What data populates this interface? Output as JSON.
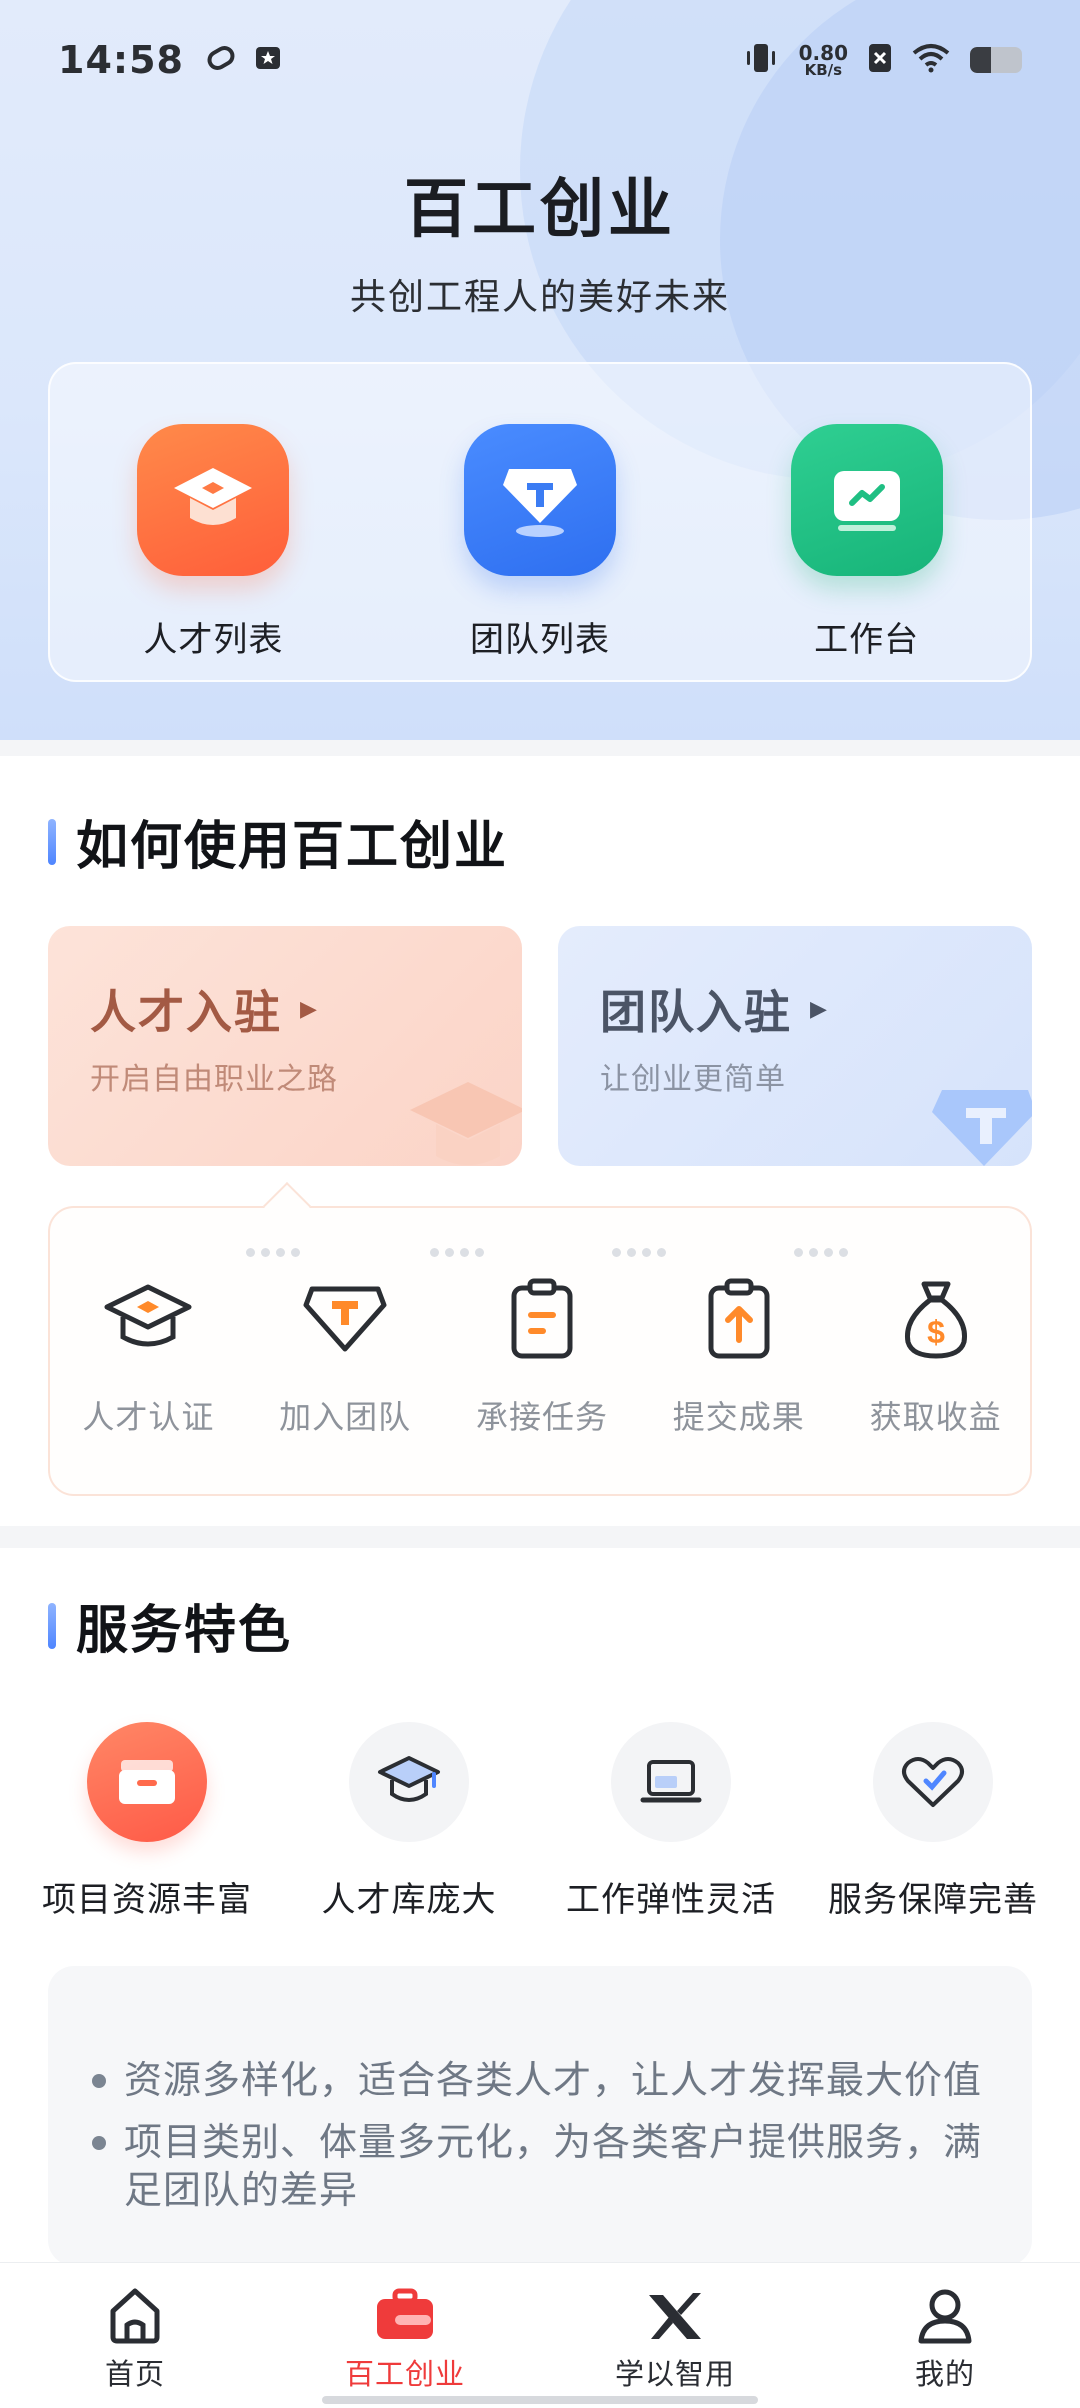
{
  "status": {
    "time": "14:58",
    "speed_value": "0.80",
    "speed_unit": "KB/s"
  },
  "header": {
    "title": "百工创业",
    "subtitle": "共创工程人的美好未来"
  },
  "quick_actions": [
    {
      "label": "人才列表",
      "icon": "graduation-cap-icon",
      "color": "#ff6b3d"
    },
    {
      "label": "团队列表",
      "icon": "team-gem-icon",
      "color": "#3a7cf5"
    },
    {
      "label": "工作台",
      "icon": "dashboard-monitor-icon",
      "color": "#1fbf83"
    }
  ],
  "how_to": {
    "title": "如何使用百工创业",
    "talent_card": {
      "title": "人才入驻",
      "subtitle": "开启自由职业之路"
    },
    "team_card": {
      "title": "团队入驻",
      "subtitle": "让创业更简单"
    },
    "steps": [
      {
        "label": "人才认证",
        "icon": "certification-cap-icon"
      },
      {
        "label": "加入团队",
        "icon": "join-team-icon"
      },
      {
        "label": "承接任务",
        "icon": "task-clipboard-icon"
      },
      {
        "label": "提交成果",
        "icon": "submit-upload-icon"
      },
      {
        "label": "获取收益",
        "icon": "money-bag-icon"
      }
    ]
  },
  "features": {
    "title": "服务特色",
    "items": [
      {
        "label": "项目资源丰富",
        "icon": "project-box-icon",
        "active": true
      },
      {
        "label": "人才库庞大",
        "icon": "talent-cap-icon",
        "active": false
      },
      {
        "label": "工作弹性灵活",
        "icon": "laptop-icon",
        "active": false
      },
      {
        "label": "服务保障完善",
        "icon": "heart-shield-icon",
        "active": false
      }
    ],
    "bullets": [
      "资源多样化，适合各类人才，让人才发挥最大价值",
      "项目类别、体量多元化，为各类客户提供服务，满足团队的差异"
    ]
  },
  "tabbar": [
    {
      "label": "首页",
      "icon": "home-icon",
      "active": false
    },
    {
      "label": "百工创业",
      "icon": "briefcase-icon",
      "active": true
    },
    {
      "label": "学以智用",
      "icon": "x-logo-icon",
      "active": false
    },
    {
      "label": "我的",
      "icon": "user-icon",
      "active": false
    }
  ],
  "colors": {
    "accent_red": "#ef3b3b",
    "title_bar_blue": "#4f86ff"
  }
}
